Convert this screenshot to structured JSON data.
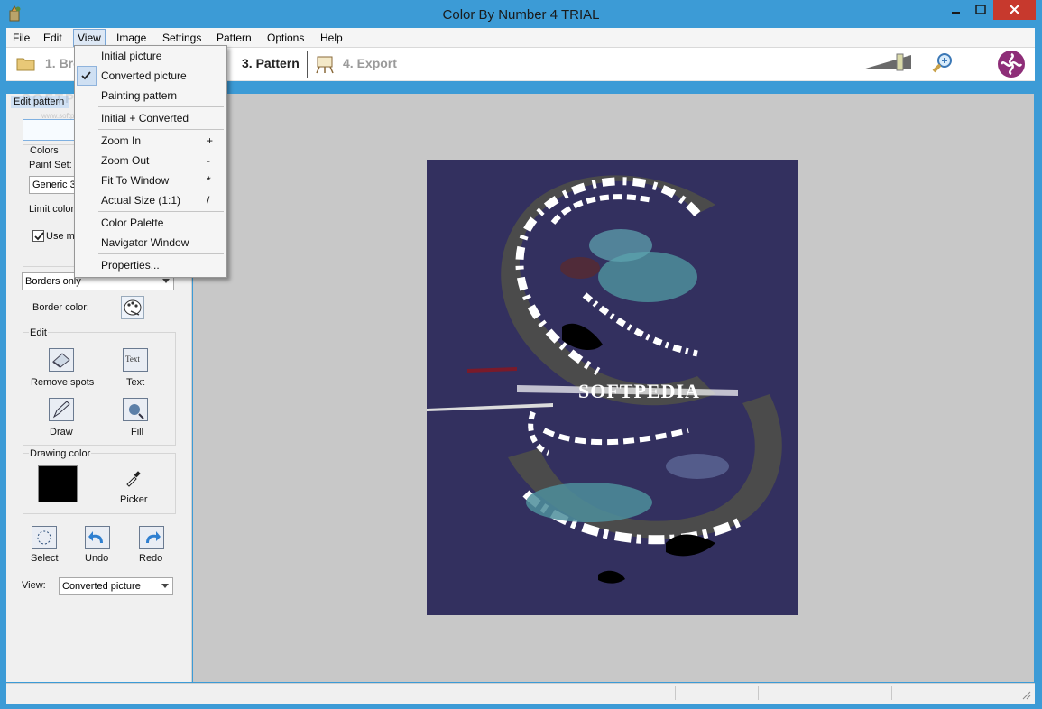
{
  "window": {
    "title": "Color By Number 4 TRIAL"
  },
  "menubar": {
    "items": [
      {
        "label": "File"
      },
      {
        "label": "Edit"
      },
      {
        "label": "View"
      },
      {
        "label": "Image"
      },
      {
        "label": "Settings"
      },
      {
        "label": "Pattern"
      },
      {
        "label": "Options"
      },
      {
        "label": "Help"
      }
    ]
  },
  "toolbar": {
    "steps": [
      {
        "label": "1. Bro"
      },
      {
        "label": "3. Pattern"
      },
      {
        "label": "4. Export"
      }
    ]
  },
  "view_menu": {
    "items": [
      {
        "label": "Initial picture",
        "shortcut": ""
      },
      {
        "label": "Converted picture",
        "shortcut": "",
        "checked": true
      },
      {
        "label": "Painting pattern",
        "shortcut": ""
      },
      {
        "label": "Initial + Converted",
        "shortcut": ""
      },
      {
        "label": "Zoom In",
        "shortcut": "+"
      },
      {
        "label": "Zoom Out",
        "shortcut": "-"
      },
      {
        "label": "Fit To Window",
        "shortcut": "*"
      },
      {
        "label": "Actual Size (1:1)",
        "shortcut": "/"
      },
      {
        "label": "Color Palette",
        "shortcut": ""
      },
      {
        "label": "Navigator Window",
        "shortcut": ""
      },
      {
        "label": "Properties...",
        "shortcut": ""
      }
    ]
  },
  "sidebar": {
    "panel_title": "Edit pattern",
    "colors_group": "Colors",
    "paint_set_label": "Paint Set:",
    "paint_set_value": "Generic 3",
    "limit_colors_label": "Limit colors",
    "use_checkbox_label": "Use mi",
    "borders_value": "Borders only",
    "border_color_label": "Border color:",
    "edit_group": "Edit",
    "remove_spots": "Remove spots",
    "text_label": "Text",
    "text_icon_caption": "Text",
    "draw_label": "Draw",
    "fill_label": "Fill",
    "drawing_color_group": "Drawing color",
    "drawing_color_value": "#000000",
    "picker_label": "Picker",
    "select_label": "Select",
    "undo_label": "Undo",
    "redo_label": "Redo",
    "view_label": "View:",
    "view_value": "Converted picture"
  },
  "canvas": {
    "image_text": "SOFTPEDIA"
  },
  "watermark": {
    "text": "SOFTPEDIA",
    "sub": "www.softpedia.com"
  },
  "colors": {
    "accent": "#3c9bd6",
    "image_bg": "#33305f"
  }
}
